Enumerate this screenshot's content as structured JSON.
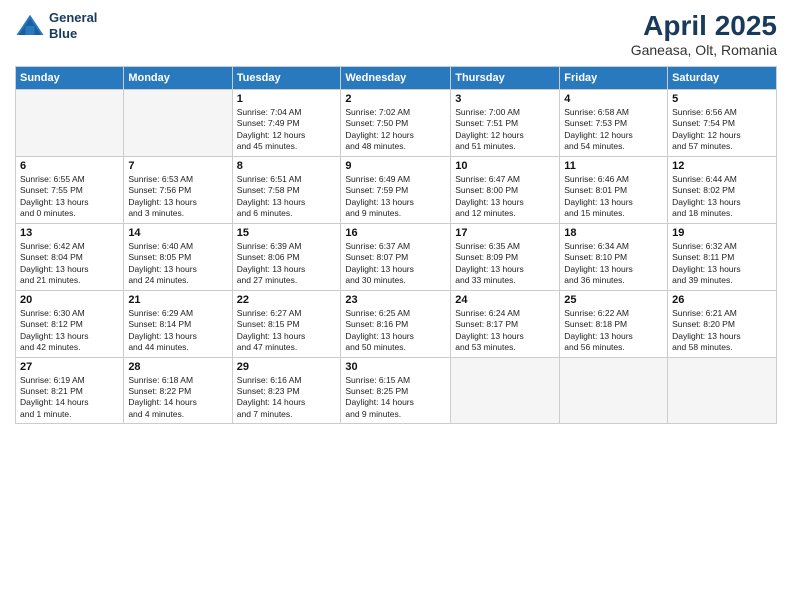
{
  "header": {
    "logo_line1": "General",
    "logo_line2": "Blue",
    "title": "April 2025",
    "subtitle": "Ganeasa, Olt, Romania"
  },
  "days_of_week": [
    "Sunday",
    "Monday",
    "Tuesday",
    "Wednesday",
    "Thursday",
    "Friday",
    "Saturday"
  ],
  "weeks": [
    [
      {
        "num": "",
        "info": ""
      },
      {
        "num": "",
        "info": ""
      },
      {
        "num": "1",
        "info": "Sunrise: 7:04 AM\nSunset: 7:49 PM\nDaylight: 12 hours\nand 45 minutes."
      },
      {
        "num": "2",
        "info": "Sunrise: 7:02 AM\nSunset: 7:50 PM\nDaylight: 12 hours\nand 48 minutes."
      },
      {
        "num": "3",
        "info": "Sunrise: 7:00 AM\nSunset: 7:51 PM\nDaylight: 12 hours\nand 51 minutes."
      },
      {
        "num": "4",
        "info": "Sunrise: 6:58 AM\nSunset: 7:53 PM\nDaylight: 12 hours\nand 54 minutes."
      },
      {
        "num": "5",
        "info": "Sunrise: 6:56 AM\nSunset: 7:54 PM\nDaylight: 12 hours\nand 57 minutes."
      }
    ],
    [
      {
        "num": "6",
        "info": "Sunrise: 6:55 AM\nSunset: 7:55 PM\nDaylight: 13 hours\nand 0 minutes."
      },
      {
        "num": "7",
        "info": "Sunrise: 6:53 AM\nSunset: 7:56 PM\nDaylight: 13 hours\nand 3 minutes."
      },
      {
        "num": "8",
        "info": "Sunrise: 6:51 AM\nSunset: 7:58 PM\nDaylight: 13 hours\nand 6 minutes."
      },
      {
        "num": "9",
        "info": "Sunrise: 6:49 AM\nSunset: 7:59 PM\nDaylight: 13 hours\nand 9 minutes."
      },
      {
        "num": "10",
        "info": "Sunrise: 6:47 AM\nSunset: 8:00 PM\nDaylight: 13 hours\nand 12 minutes."
      },
      {
        "num": "11",
        "info": "Sunrise: 6:46 AM\nSunset: 8:01 PM\nDaylight: 13 hours\nand 15 minutes."
      },
      {
        "num": "12",
        "info": "Sunrise: 6:44 AM\nSunset: 8:02 PM\nDaylight: 13 hours\nand 18 minutes."
      }
    ],
    [
      {
        "num": "13",
        "info": "Sunrise: 6:42 AM\nSunset: 8:04 PM\nDaylight: 13 hours\nand 21 minutes."
      },
      {
        "num": "14",
        "info": "Sunrise: 6:40 AM\nSunset: 8:05 PM\nDaylight: 13 hours\nand 24 minutes."
      },
      {
        "num": "15",
        "info": "Sunrise: 6:39 AM\nSunset: 8:06 PM\nDaylight: 13 hours\nand 27 minutes."
      },
      {
        "num": "16",
        "info": "Sunrise: 6:37 AM\nSunset: 8:07 PM\nDaylight: 13 hours\nand 30 minutes."
      },
      {
        "num": "17",
        "info": "Sunrise: 6:35 AM\nSunset: 8:09 PM\nDaylight: 13 hours\nand 33 minutes."
      },
      {
        "num": "18",
        "info": "Sunrise: 6:34 AM\nSunset: 8:10 PM\nDaylight: 13 hours\nand 36 minutes."
      },
      {
        "num": "19",
        "info": "Sunrise: 6:32 AM\nSunset: 8:11 PM\nDaylight: 13 hours\nand 39 minutes."
      }
    ],
    [
      {
        "num": "20",
        "info": "Sunrise: 6:30 AM\nSunset: 8:12 PM\nDaylight: 13 hours\nand 42 minutes."
      },
      {
        "num": "21",
        "info": "Sunrise: 6:29 AM\nSunset: 8:14 PM\nDaylight: 13 hours\nand 44 minutes."
      },
      {
        "num": "22",
        "info": "Sunrise: 6:27 AM\nSunset: 8:15 PM\nDaylight: 13 hours\nand 47 minutes."
      },
      {
        "num": "23",
        "info": "Sunrise: 6:25 AM\nSunset: 8:16 PM\nDaylight: 13 hours\nand 50 minutes."
      },
      {
        "num": "24",
        "info": "Sunrise: 6:24 AM\nSunset: 8:17 PM\nDaylight: 13 hours\nand 53 minutes."
      },
      {
        "num": "25",
        "info": "Sunrise: 6:22 AM\nSunset: 8:18 PM\nDaylight: 13 hours\nand 56 minutes."
      },
      {
        "num": "26",
        "info": "Sunrise: 6:21 AM\nSunset: 8:20 PM\nDaylight: 13 hours\nand 58 minutes."
      }
    ],
    [
      {
        "num": "27",
        "info": "Sunrise: 6:19 AM\nSunset: 8:21 PM\nDaylight: 14 hours\nand 1 minute."
      },
      {
        "num": "28",
        "info": "Sunrise: 6:18 AM\nSunset: 8:22 PM\nDaylight: 14 hours\nand 4 minutes."
      },
      {
        "num": "29",
        "info": "Sunrise: 6:16 AM\nSunset: 8:23 PM\nDaylight: 14 hours\nand 7 minutes."
      },
      {
        "num": "30",
        "info": "Sunrise: 6:15 AM\nSunset: 8:25 PM\nDaylight: 14 hours\nand 9 minutes."
      },
      {
        "num": "",
        "info": ""
      },
      {
        "num": "",
        "info": ""
      },
      {
        "num": "",
        "info": ""
      }
    ]
  ]
}
